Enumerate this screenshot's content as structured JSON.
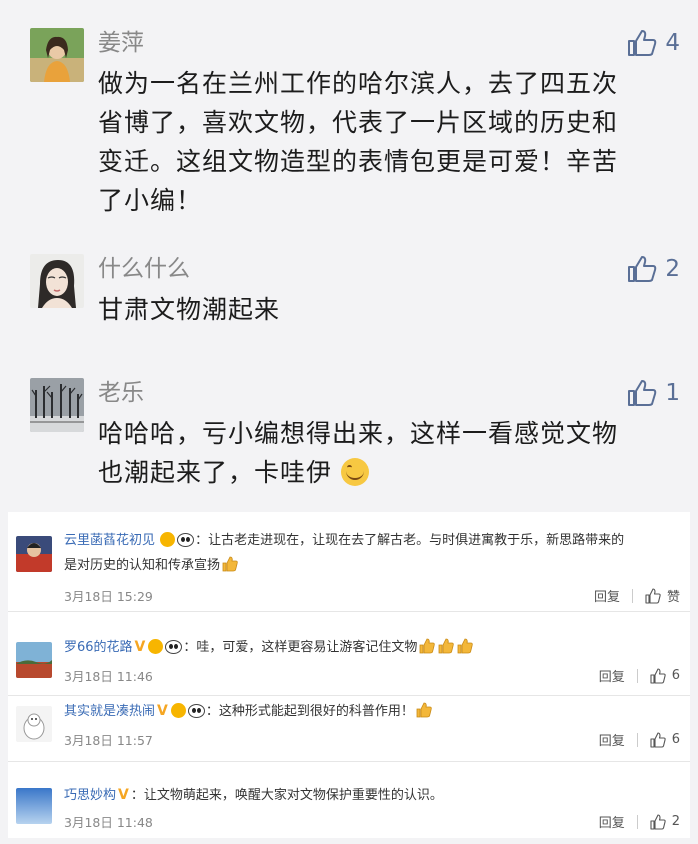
{
  "wechat_comments": [
    {
      "name": "姜萍",
      "likes": "4",
      "lines": [
        "做为一名在兰州工作的哈尔滨人，去了四五次",
        "省博了，喜欢文物，代表了一片区域的历史和",
        "变迁。这组文物造型的表情包更是可爱！辛苦",
        "了小编！"
      ]
    },
    {
      "name": "什么什么",
      "likes": "2",
      "lines": [
        "甘肃文物潮起来"
      ]
    },
    {
      "name": "老乐",
      "likes": "1",
      "lines": [
        "哈哈哈，亏小编想得出来，这样一看感觉文物",
        "也潮起来了，卡哇伊"
      ]
    }
  ],
  "weibo_comments": [
    {
      "name": "云里菡萏花初见",
      "text_line1": "：让古老走进现在，让现在去了解古老。与时俱进寓教于乐，新思路带来的",
      "text_line2": "是对历史的认知和传承宣扬",
      "date": "3月18日 15:29",
      "reply": "回复",
      "like": "赞"
    },
    {
      "name": "罗66的花路",
      "text_line1": "：哇，可爱，这样更容易让游客记住文物",
      "date": "3月18日 11:46",
      "reply": "回复",
      "like": "6"
    },
    {
      "name": "其实就是凑热闹",
      "text_line1": "：这种形式能起到很好的科普作用！",
      "date": "3月18日 11:57",
      "reply": "回复",
      "like": "6"
    },
    {
      "name": "巧思妙构",
      "text_line1": "：让文物萌起来，唤醒大家对文物保护重要性的认识。",
      "date": "3月18日 11:48",
      "reply": "回复",
      "like": "2"
    }
  ],
  "colors": {
    "wechat_bg": "#f3f3f5",
    "weibo_name": "#3a6bb5",
    "like_icon": "#5a6f96",
    "vip_badge": "#f5a623"
  },
  "icons": [
    "thumbs-up-icon",
    "smile-emoji-icon",
    "vip-v-badge-icon",
    "panda-badge-icon"
  ]
}
